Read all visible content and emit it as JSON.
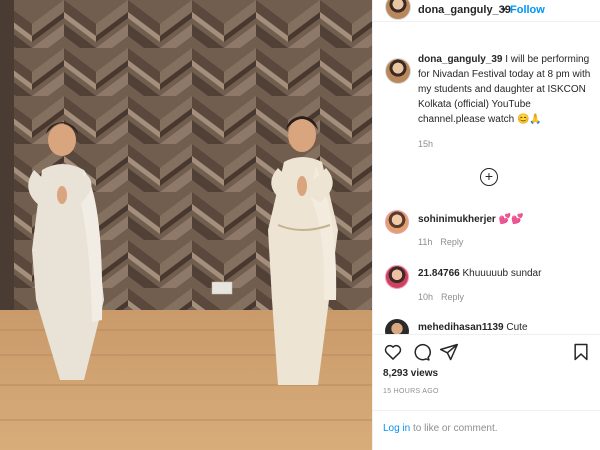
{
  "post": {
    "username": "dona_ganguly_39",
    "header_separator": "•",
    "follow_label": "Follow",
    "caption_username": "dona_ganguly_39",
    "caption_text": " I will be performing for Nivadan Festival today at 8 pm with my students and daughter at ISKCON Kolkata (official) YouTube channel.please watch 😊🙏",
    "caption_time": "15h",
    "load_more_symbol": "+"
  },
  "comments": [
    {
      "username": "sohinimukherjer",
      "text": " 💕💕",
      "time": "11h",
      "reply_label": "Reply"
    },
    {
      "username": "21.84766",
      "text": " Khuuuuub sundar",
      "time": "10h",
      "reply_label": "Reply"
    },
    {
      "username": "mehedihasan1139",
      "text": " Cute",
      "time": "",
      "reply_label": ""
    }
  ],
  "actions": {
    "like_icon": "heart-icon",
    "comment_icon": "comment-icon",
    "share_icon": "share-icon",
    "save_icon": "bookmark-icon"
  },
  "stats": {
    "views": "8,293 views",
    "posted": "15 HOURS AGO"
  },
  "login": {
    "link_label": "Log in",
    "rest_text": " to like or comment."
  },
  "colors": {
    "link_blue": "#0095f6",
    "text": "#262626",
    "muted": "#8e8e8e",
    "border": "#efefef"
  }
}
